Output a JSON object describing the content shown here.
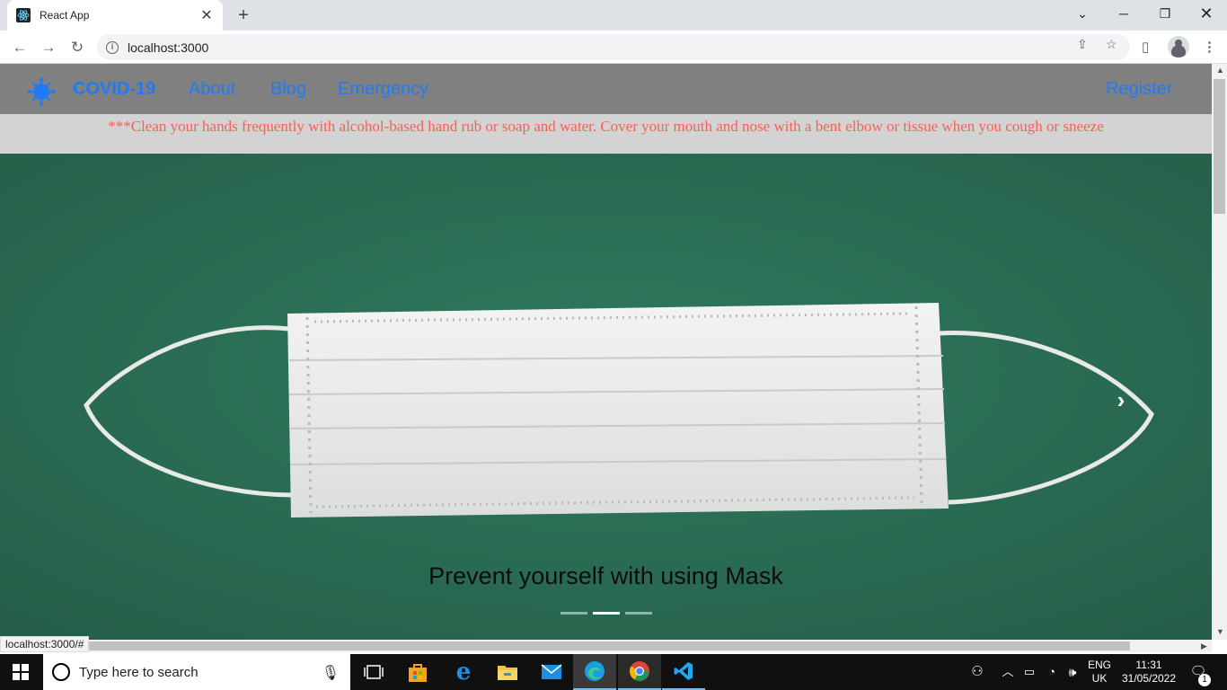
{
  "browser": {
    "tab_title": "React App",
    "tab_close": "✕",
    "new_tab": "+",
    "url": "localhost:3000",
    "status_url": "localhost:3000/#"
  },
  "navbar": {
    "brand": "COVID-19",
    "links": [
      "About",
      "Blog",
      "Emergency"
    ],
    "register": "Register",
    "accent_color": "#1e7bf5",
    "background_color": "#808080"
  },
  "banner": {
    "text": "***Clean your hands frequently with alcohol-based hand rub or soap and water. Cover your mouth and nose with a bent elbow or tissue when you cough or sneeze",
    "text_color": "#fa5f55"
  },
  "carousel": {
    "caption": "Prevent yourself with using Mask",
    "slide_count": 3,
    "active_slide": 2,
    "next_icon": "chevron-right-icon",
    "background_color": "#2b7358"
  },
  "taskbar": {
    "search_placeholder": "Type here to search",
    "language_line1": "ENG",
    "language_line2": "UK",
    "time": "11:31",
    "date": "31/05/2022",
    "notification_count": "1"
  }
}
